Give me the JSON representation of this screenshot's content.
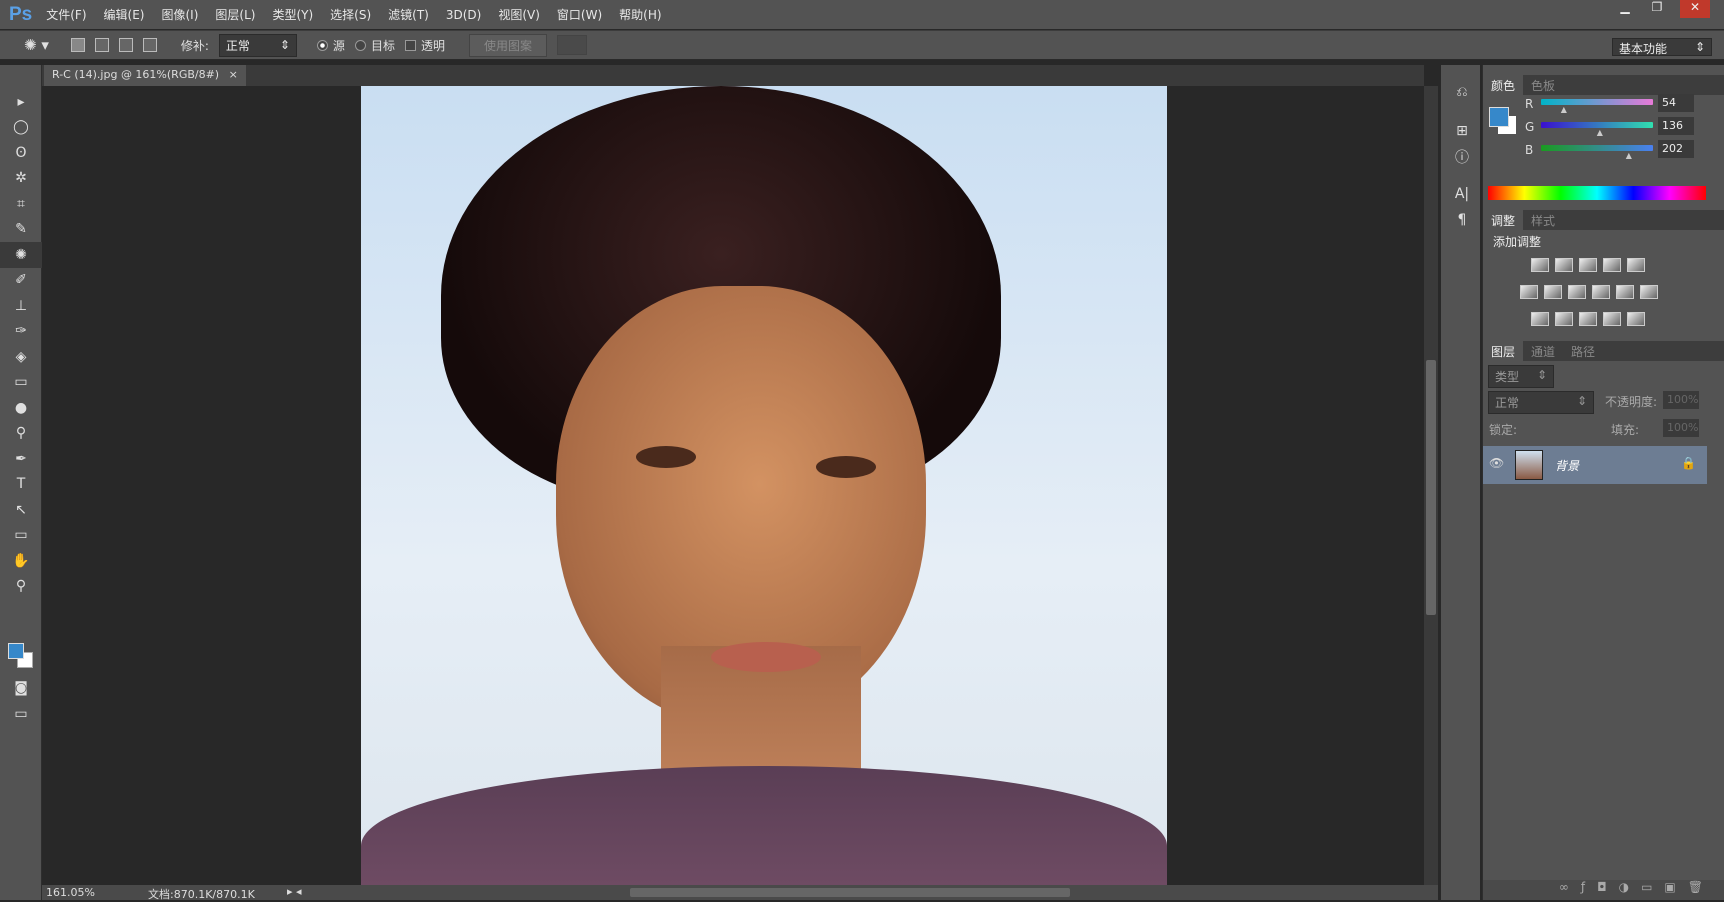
{
  "app": {
    "logo": "Ps",
    "menus": [
      "文件(F)",
      "编辑(E)",
      "图像(I)",
      "图层(L)",
      "类型(Y)",
      "选择(S)",
      "滤镜(T)",
      "3D(D)",
      "视图(V)",
      "窗口(W)",
      "帮助(H)"
    ],
    "window_controls": [
      "▁",
      "❐",
      "✕"
    ]
  },
  "options": {
    "patch_label": "修补:",
    "patch_value": "正常",
    "source_label": "源",
    "target_label": "目标",
    "transparent_label": "透明",
    "use_pattern": "使用图案",
    "workspace": "基本功能"
  },
  "document": {
    "tab_title": "R-C (14).jpg @ 161%(RGB/8#)",
    "close": "×"
  },
  "tools": [
    "▸",
    "◯",
    "ʘ",
    "✲",
    "⌗",
    "✎",
    "✺",
    "✐",
    "⊥",
    "✑",
    "◈",
    "▭",
    "●",
    "⚲",
    "✒",
    "T",
    "↖",
    "▭",
    "✋",
    "⚲"
  ],
  "color_panel": {
    "tabs": [
      "颜色",
      "色板"
    ],
    "foreground": "#3688ca",
    "channels": [
      {
        "name": "R",
        "value": 54
      },
      {
        "name": "G",
        "value": 136
      },
      {
        "name": "B",
        "value": 202
      }
    ]
  },
  "adjust_panel": {
    "tabs": [
      "调整",
      "样式"
    ],
    "title": "添加调整"
  },
  "layers_panel": {
    "tabs": [
      "图层",
      "通道",
      "路径"
    ],
    "filter": "类型",
    "blend": "正常",
    "opacity_label": "不透明度:",
    "opacity": "100%",
    "lock_label": "锁定:",
    "fill_label": "填充:",
    "fill": "100%",
    "layers": [
      {
        "name": "背景"
      }
    ]
  },
  "status": {
    "zoom": "161.05%",
    "doc": "文档:870.1K/870.1K"
  }
}
